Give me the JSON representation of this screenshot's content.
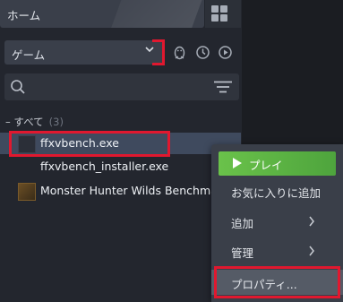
{
  "header": {
    "home_label": "ホーム"
  },
  "sidebar": {
    "collection_select": "ゲーム",
    "search": {
      "placeholder": "",
      "value": ""
    },
    "section": {
      "label": "すべて",
      "count": "(3)"
    },
    "games": [
      {
        "name": "ffxvbench.exe",
        "selected": true
      },
      {
        "name": "ffxvbench_installer.exe",
        "selected": false
      },
      {
        "name": "Monster Hunter Wilds Benchmark",
        "selected": false
      }
    ]
  },
  "context_menu": {
    "play_label": "プレイ",
    "items": [
      {
        "label": "お気に入りに追加",
        "submenu": false
      },
      {
        "label": "追加",
        "submenu": true
      },
      {
        "label": "管理",
        "submenu": true
      },
      {
        "label": "プロパティ...",
        "submenu": false
      }
    ]
  },
  "colors": {
    "play_button": "#5bb642",
    "selection": "#3f4a5e",
    "highlight_annotation": "#e0182f"
  }
}
